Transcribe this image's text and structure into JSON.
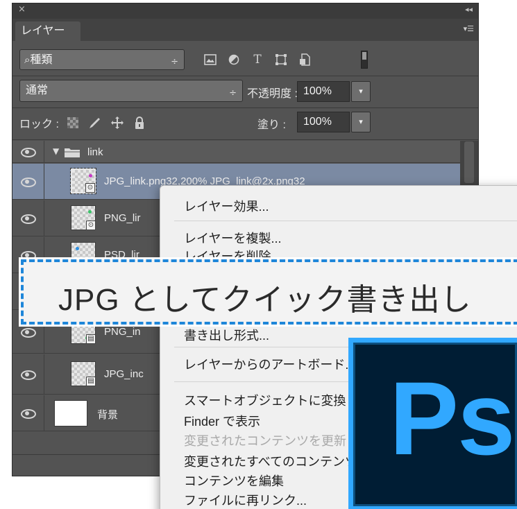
{
  "panel": {
    "close_glyph": "×",
    "collapse_glyph": "◂◂",
    "tab_label": "レイヤー",
    "menu_glyph": "▾☰",
    "filter": {
      "search_glyph": "⌕",
      "label": "種類",
      "arrows": "÷"
    },
    "filter_icons": [
      "image-filter-icon",
      "adjustment-filter-icon",
      "type-filter-icon",
      "shape-filter-icon",
      "smart-object-filter-icon"
    ],
    "filter_type_glyph": "T",
    "blend": {
      "label": "通常",
      "arrows": "÷"
    },
    "opacity": {
      "label": "不透明度 :",
      "value": "100%",
      "dd": "▾"
    },
    "lock": {
      "label": "ロック :",
      "icons": [
        "lock-transparent-icon",
        "lock-image-icon",
        "lock-position-icon",
        "lock-all-icon"
      ]
    },
    "fill": {
      "label": "塗り :",
      "value": "100%",
      "dd": "▾"
    }
  },
  "layers": {
    "group_name": "link",
    "items": [
      {
        "name": "JPG_link.png32,200% JPG_link@2x.png32"
      },
      {
        "name": "PNG_lir"
      },
      {
        "name": "PSD_lir"
      },
      {
        "name": "PNG_in"
      },
      {
        "name": "JPG_inc"
      },
      {
        "name": "背景"
      }
    ]
  },
  "context_menu": {
    "items": [
      {
        "label": "レイヤー効果...",
        "disabled": false
      },
      {
        "label": "レイヤーを複製...",
        "disabled": false
      },
      {
        "label": "レイヤーを削除",
        "disabled": false
      },
      {
        "label": "書き出し形式...",
        "disabled": false
      },
      {
        "label": "レイヤーからのアートボード...",
        "disabled": false
      },
      {
        "label": "スマートオブジェクトに変換",
        "disabled": false
      },
      {
        "label": "Finder で表示",
        "disabled": false
      },
      {
        "label": "変更されたコンテンツを更新",
        "disabled": true
      },
      {
        "label": "変更されたすべてのコンテンツを更新",
        "disabled": false
      },
      {
        "label": "コンテンツを編集",
        "disabled": false
      },
      {
        "label": "ファイルに再リンク...",
        "disabled": false
      }
    ]
  },
  "callout": {
    "text": "JPG としてクイック書き出し",
    "border_color": "#1e86d9"
  },
  "logo": {
    "text": "Ps",
    "accent": "#31a8ff",
    "background": "#001d34"
  },
  "colors": {
    "panel_bg": "#535353",
    "selected_row": "#7b8aa3"
  }
}
